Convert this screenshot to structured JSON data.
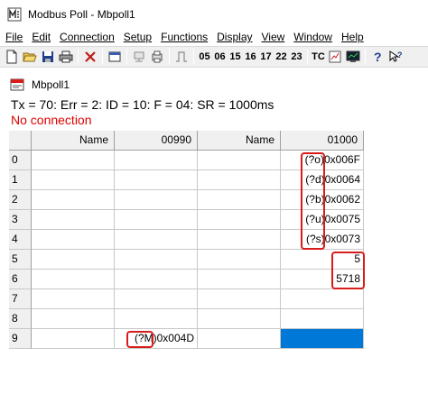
{
  "window": {
    "title": "Modbus Poll - Mbpoll1"
  },
  "menu": [
    {
      "label": "File"
    },
    {
      "label": "Edit"
    },
    {
      "label": "Connection"
    },
    {
      "label": "Setup"
    },
    {
      "label": "Functions"
    },
    {
      "label": "Display"
    },
    {
      "label": "View"
    },
    {
      "label": "Window"
    },
    {
      "label": "Help"
    }
  ],
  "toolbar": {
    "icons": [
      "new-icon",
      "open-icon",
      "save-icon",
      "print-icon",
      "delete-icon",
      "window-icon",
      "connect-icon",
      "printer-icon",
      "pulse-icon"
    ],
    "function_codes": [
      "05",
      "06",
      "15",
      "16",
      "17",
      "22",
      "23"
    ],
    "tc_label": "TC",
    "trailing_icons": [
      "chart-icon",
      "monitor-icon",
      "help-icon",
      "pointer-help-icon"
    ]
  },
  "document": {
    "title": "Mbpoll1",
    "status": "Tx = 70: Err = 2: ID = 10: F = 04: SR = 1000ms",
    "connection": "No connection"
  },
  "grid": {
    "columns": [
      {
        "header": "Name"
      },
      {
        "header": "00990"
      },
      {
        "header": "Name"
      },
      {
        "header": "01000"
      }
    ],
    "rows": [
      {
        "index": "0",
        "c1": "",
        "c3_prefix": "(?o)",
        "c3": "0x006F"
      },
      {
        "index": "1",
        "c1": "",
        "c3_prefix": "(?d)",
        "c3": "0x0064"
      },
      {
        "index": "2",
        "c1": "",
        "c3_prefix": "(?b)",
        "c3": "0x0062"
      },
      {
        "index": "3",
        "c1": "",
        "c3_prefix": "(?u)",
        "c3": "0x0075"
      },
      {
        "index": "4",
        "c1": "",
        "c3_prefix": "(?s)",
        "c3": "0x0073"
      },
      {
        "index": "5",
        "c1": "",
        "c3_prefix": "",
        "c3": "5"
      },
      {
        "index": "6",
        "c1": "",
        "c3_prefix": "",
        "c3": "5718"
      },
      {
        "index": "7",
        "c1": "",
        "c3_prefix": "",
        "c3": ""
      },
      {
        "index": "8",
        "c1": "",
        "c3_prefix": "",
        "c3": ""
      },
      {
        "index": "9",
        "c1_prefix": "(?M)",
        "c1": "0x004D",
        "c3_prefix": "",
        "c3": ""
      }
    ]
  },
  "colors": {
    "highlight": "#d81b1b",
    "selection": "#0078d7",
    "error_text": "#e00000"
  }
}
